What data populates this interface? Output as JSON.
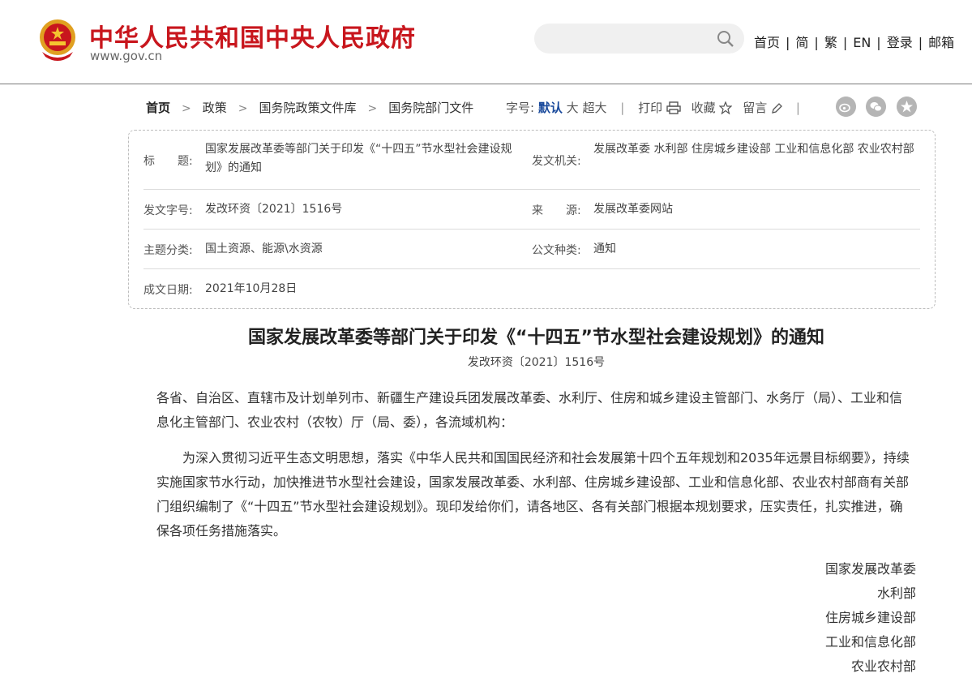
{
  "header": {
    "site_name": "中华人民共和国中央人民政府",
    "domain": "www.gov.cn",
    "search_placeholder": "",
    "nav": [
      "首页",
      "简",
      "繁",
      "EN",
      "登录",
      "邮箱"
    ]
  },
  "breadcrumb": [
    "首页",
    "政策",
    "国务院政策文件库",
    "国务院部门文件"
  ],
  "tools": {
    "font_label": "字号:",
    "font_default": "默认",
    "font_large": "大",
    "font_xlarge": "超大",
    "print": "打印",
    "favorite": "收藏",
    "comment": "留言"
  },
  "info": {
    "title_label": "标　　题:",
    "title_value": "国家发展改革委等部门关于印发《“十四五”节水型社会建设规划》的通知",
    "issuer_label": "发文机关:",
    "issuer_value": "发展改革委  水利部  住房城乡建设部  工业和信息化部  农业农村部",
    "docno_label": "发文字号:",
    "docno_value": "发改环资〔2021〕1516号",
    "source_label": "来　　源:",
    "source_value": "发展改革委网站",
    "topic_label": "主题分类:",
    "topic_value": "国土资源、能源\\水资源",
    "type_label": "公文种类:",
    "type_value": "通知",
    "date_label": "成文日期:",
    "date_value": "2021年10月28日"
  },
  "article": {
    "title": "国家发展改革委等部门关于印发《“十四五”节水型社会建设规划》的通知",
    "docno": "发改环资〔2021〕1516号",
    "p1": "各省、自治区、直辖市及计划单列市、新疆生产建设兵团发展改革委、水利厅、住房和城乡建设主管部门、水务厅（局）、工业和信息化主管部门、农业农村（农牧）厅（局、委），各流域机构：",
    "p2": "为深入贯彻习近平生态文明思想，落实《中华人民共和国国民经济和社会发展第十四个五年规划和2035年远景目标纲要》，持续实施国家节水行动，加快推进节水型社会建设，国家发展改革委、水利部、住房城乡建设部、工业和信息化部、农业农村部商有关部门组织编制了《“十四五”节水型社会建设规划》。现印发给你们，请各地区、各有关部门根据本规划要求，压实责任，扎实推进，确保各项任务措施落实。",
    "signatures": [
      "国家发展改革委",
      "水利部",
      "住房城乡建设部",
      "工业和信息化部",
      "农业农村部"
    ]
  },
  "colors": {
    "brand_red": "#c8161d",
    "link_blue": "#1a4a9c"
  },
  "icons": [
    "national-emblem-icon",
    "search-icon",
    "print-icon",
    "star-icon",
    "pencil-icon",
    "weibo-icon",
    "wechat-icon",
    "qzone-icon"
  ]
}
